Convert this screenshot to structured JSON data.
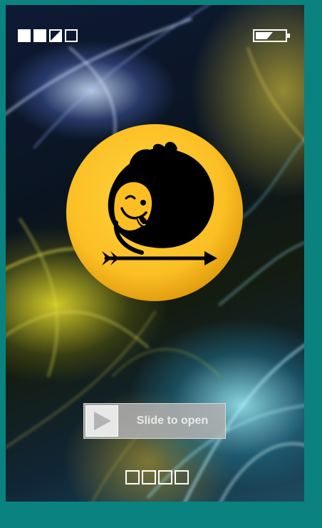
{
  "status_bar": {
    "signal_icon": "signal-strength-icon",
    "signal_bars": [
      "full",
      "full",
      "half",
      "empty"
    ],
    "battery_icon": "battery-icon",
    "battery_level": 0.6
  },
  "logo": {
    "icon": "smiling-creature-arrow-logo-icon",
    "badge_color": "#fbbf24"
  },
  "unlock": {
    "label": "Slide to open",
    "handle_icon": "play-arrow-icon"
  },
  "pager": {
    "pages": 4,
    "icon": "page-indicator-squares"
  },
  "colors": {
    "frame": "#0a8380",
    "badge": "#fbbf24",
    "slider": "#afafaf"
  }
}
